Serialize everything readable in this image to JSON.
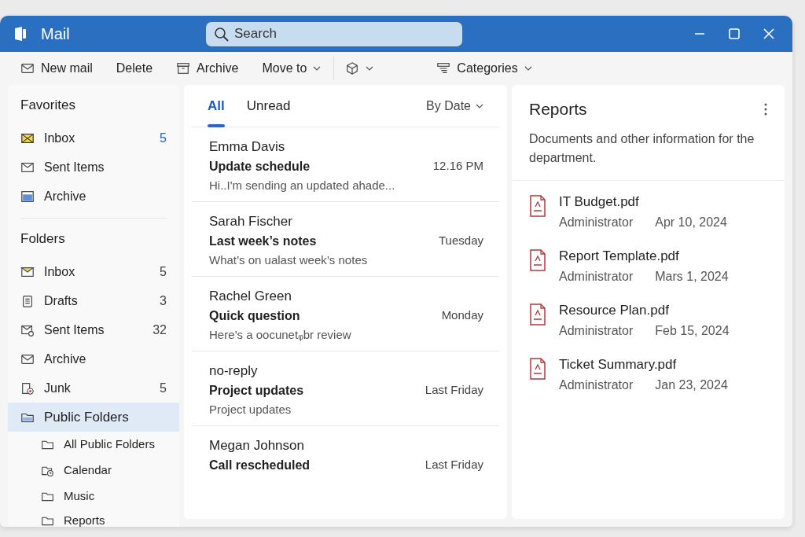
{
  "window": {
    "title": "Mail"
  },
  "search": {
    "placeholder": "Search"
  },
  "toolbar": [
    {
      "label": "New mail",
      "kind": "mail",
      "dropdown": false
    },
    {
      "label": "Delete",
      "kind": "plain",
      "dropdown": false
    },
    {
      "label": "Archive",
      "kind": "archive",
      "dropdown": false
    },
    {
      "label": "Move to",
      "kind": "plain",
      "dropdown": true
    },
    {
      "kind": "tag",
      "dropdown": true
    },
    {
      "label": "Categories",
      "kind": "categories",
      "dropdown": true
    }
  ],
  "sidebar": {
    "sections": [
      {
        "title": "Favorites",
        "items": [
          {
            "label": "Inbox",
            "kind": "inbox-yellow",
            "count": "5",
            "highlighted": true,
            "selected": false
          },
          {
            "label": "Sent Items",
            "kind": "sent",
            "selected": false
          },
          {
            "label": "Archive",
            "kind": "archive-blue",
            "selected": false
          }
        ]
      },
      {
        "title": "Folders",
        "items": [
          {
            "label": "Inbox",
            "kind": "inbox",
            "count": "5",
            "highlighted": false,
            "selected": false
          },
          {
            "label": "Drafts",
            "kind": "drafts",
            "count": "3",
            "highlighted": false,
            "selected": false
          },
          {
            "label": "Sent Items",
            "kind": "sent-check",
            "count": "32",
            "highlighted": false,
            "selected": false
          },
          {
            "label": "Archive",
            "kind": "mail",
            "selected": false
          },
          {
            "label": "Junk",
            "kind": "junk",
            "count": "5",
            "highlighted": false,
            "selected": false
          },
          {
            "label": "Public Folders",
            "kind": "folder-blue",
            "selected": true,
            "children": [
              {
                "label": "All Public Folders",
                "kind": "folder",
                "selected": false
              },
              {
                "label": "Calendar",
                "kind": "calendar",
                "selected": false
              },
              {
                "label": "Music",
                "kind": "folder",
                "selected": false
              },
              {
                "label": "Reports",
                "kind": "folder",
                "selected": false
              }
            ]
          }
        ]
      }
    ]
  },
  "message_list": {
    "tabs": [
      {
        "label": "All",
        "selected": true
      },
      {
        "label": "Unread",
        "selected": false
      }
    ],
    "sort": "By Date",
    "messages": [
      {
        "sender": "Emma Davis",
        "subject": "Update schedule",
        "time": "12.16 PM",
        "preview": "Hi..I'm sending an updated ahade..."
      },
      {
        "sender": "Sarah Fischer",
        "subject": "Last week’s notes",
        "time": "Tuesday",
        "preview": "What’s on ualast week’s notes"
      },
      {
        "sender": "Rachel Green",
        "subject": "Quick question",
        "time": "Monday",
        "preview": "Here’s a oocunetᵩbr review"
      },
      {
        "sender": "no-reply",
        "subject": "Project updates",
        "time": "Last Friday",
        "preview": "Project updates"
      },
      {
        "sender": "Megan Johnson",
        "subject": "Call rescheduled",
        "time": "Last Friday"
      }
    ]
  },
  "reading_pane": {
    "title": "Reports",
    "description": "Documents and other information for the department.",
    "files": [
      {
        "name": "IT Budget.pdf",
        "author": "Administrator",
        "date": "Apr 10, 2024"
      },
      {
        "name": "Report Template.pdf",
        "author": "Administrator",
        "date": "Mars 1, 2024"
      },
      {
        "name": "Resource Plan.pdf",
        "author": "Administrator",
        "date": "Feb 15, 2024"
      },
      {
        "name": "Ticket Summary.pdf",
        "author": "Administrator",
        "date": "Jan 23, 2024"
      }
    ]
  }
}
